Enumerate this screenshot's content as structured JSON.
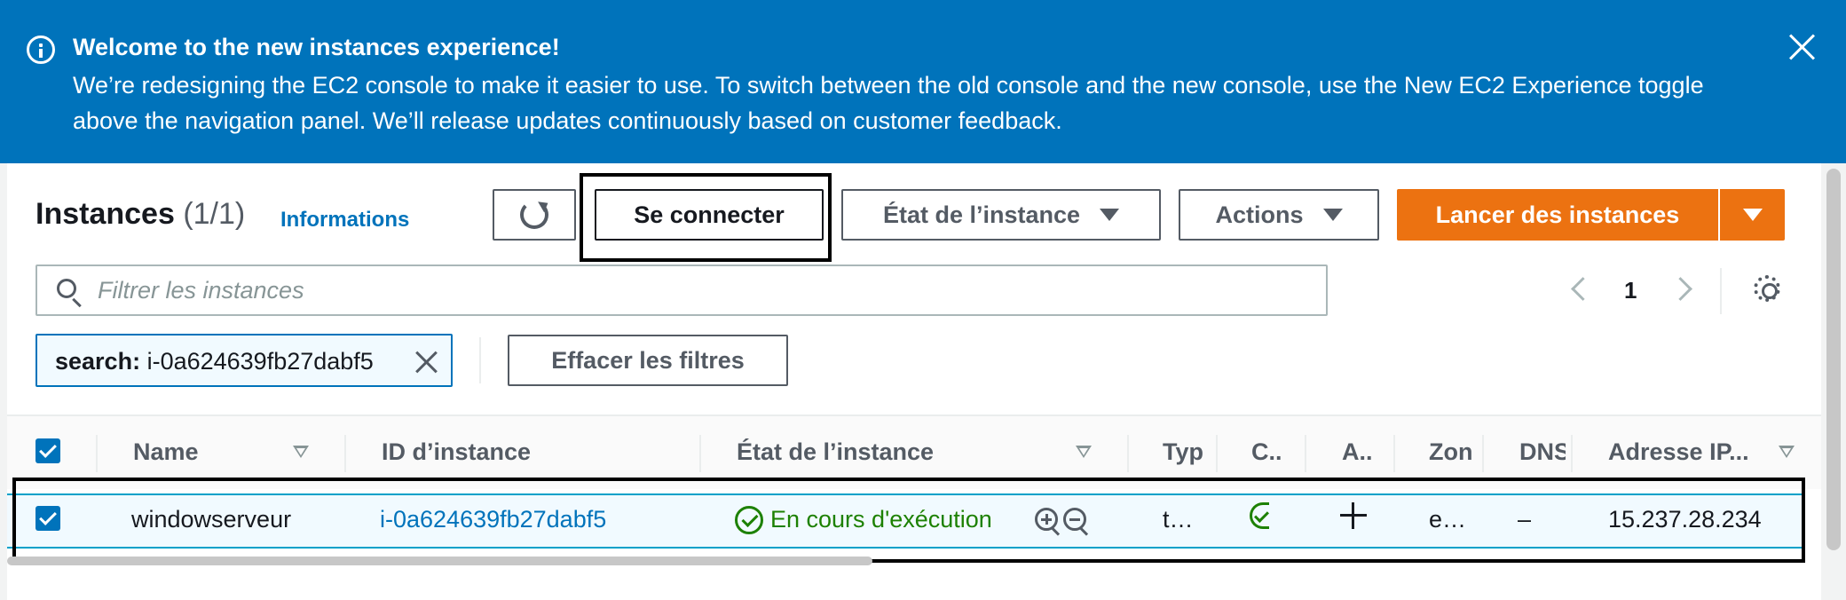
{
  "banner": {
    "title": "Welcome to the new instances experience!",
    "message": "We’re redesigning the EC2 console to make it easier to use. To switch between the old console and the new console, use the New EC2 Experience toggle above the navigation panel. We’ll release updates continuously based on customer feedback."
  },
  "header": {
    "title": "Instances",
    "count": "(1/1)",
    "info_link": "Informations"
  },
  "toolbar": {
    "connect_label": "Se connecter",
    "instance_state_label": "État de l’instance",
    "actions_label": "Actions",
    "launch_label": "Lancer des instances"
  },
  "search": {
    "placeholder": "Filtrer les instances",
    "value": ""
  },
  "pagination": {
    "current_page": "1"
  },
  "filter_token": {
    "key": "search:",
    "value": "i-0a624639fb27dabf5"
  },
  "clear_filters_label": "Effacer les filtres",
  "table": {
    "columns": [
      "Name",
      "ID d’instance",
      "État de l’instance",
      "Typ",
      "C..",
      "A..",
      "Zon",
      "DNS",
      "Adresse IP..."
    ],
    "rows": [
      {
        "name": "windowserveur",
        "instance_id": "i-0a624639fb27dabf5",
        "state": "En cours d'exécution",
        "type": "t…",
        "zone": "e…",
        "dns": "–",
        "ip": "15.237.28.234",
        "selected": true
      }
    ]
  },
  "colors": {
    "banner_bg": "#0073bb",
    "accent": "#0073bb",
    "launch_button": "#ec7211",
    "running_status": "#1d8102"
  },
  "icons": [
    "info-icon",
    "close-icon",
    "refresh-icon",
    "caret-down-icon",
    "search-icon",
    "chevron-left-icon",
    "chevron-right-icon",
    "gear-icon",
    "running-status-icon",
    "zoom-in-icon",
    "zoom-out-icon",
    "plus-icon"
  ]
}
